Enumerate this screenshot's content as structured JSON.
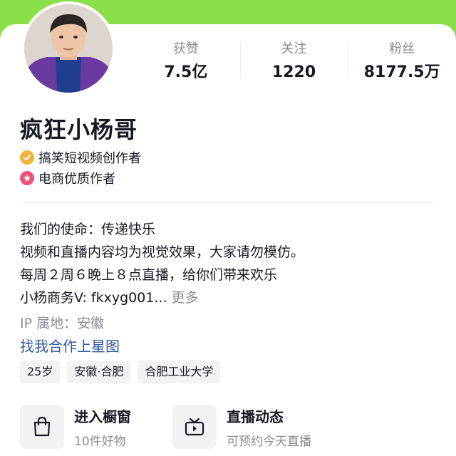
{
  "colors": {
    "accent_green": "#8be04a",
    "link_blue": "#2b5a9c",
    "muted_gray": "#8a8b91",
    "verified_gold": "#f0b33b",
    "merchant_pink": "#f0507a"
  },
  "stats": [
    {
      "label": "获赞",
      "value": "7.5亿"
    },
    {
      "label": "关注",
      "value": "1220"
    },
    {
      "label": "粉丝",
      "value": "8177.5万"
    }
  ],
  "profile": {
    "name": "疯狂小杨哥",
    "tags": [
      {
        "icon": "verified-check-icon",
        "text": "搞笑短视频创作者"
      },
      {
        "icon": "star-badge-icon",
        "text": "电商优质作者"
      }
    ],
    "bio": [
      "我们的使命：传递快乐",
      "视频和直播内容均为视觉效果，大家请勿模仿。",
      "每周２周６晚上８点直播，给你们带来欢乐",
      "小杨商务V: fkxyg001..."
    ],
    "more_label": "更多",
    "ip": "IP 属地：安徽",
    "star_map_link": "找我合作上星图",
    "chips": [
      "25岁",
      "安徽·合肥",
      "合肥工业大学"
    ]
  },
  "entries": [
    {
      "icon": "shopping-bag-icon",
      "title": "进入橱窗",
      "subtitle": "10件好物"
    },
    {
      "icon": "live-tv-icon",
      "title": "直播动态",
      "subtitle": "可预约今天直播"
    }
  ]
}
